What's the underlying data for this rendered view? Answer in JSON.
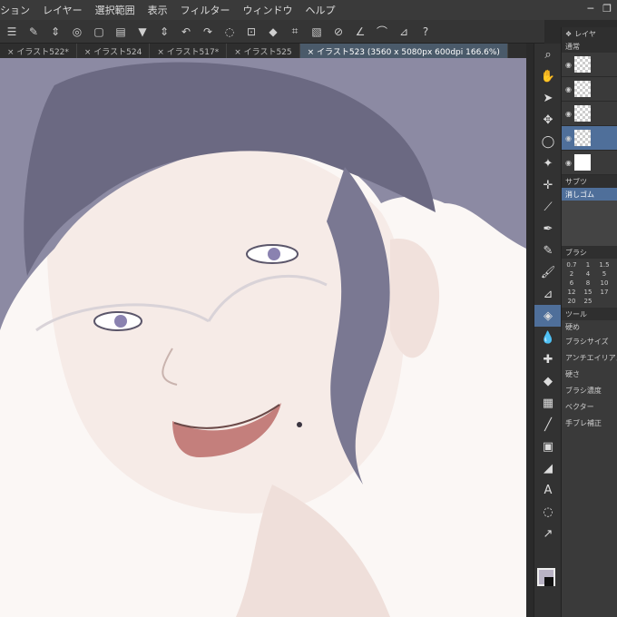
{
  "menu": {
    "items": [
      "ション",
      "レイヤー",
      "選択範囲",
      "表示",
      "フィルター",
      "ウィンドウ",
      "ヘルプ"
    ]
  },
  "tabs": [
    {
      "label": "× イラスト522*"
    },
    {
      "label": "× イラスト524"
    },
    {
      "label": "× イラスト517*"
    },
    {
      "label": "× イラスト525"
    },
    {
      "label": "× イラスト523 (3560 x 5080px 600dpi 166.6%)"
    }
  ],
  "panels": {
    "layer_header": "レイヤ",
    "blend_mode": "通常",
    "sub_tool_header": "サブツ",
    "sub_tool_selected": "消しゴム",
    "brush_header": "ブラシ",
    "brush_sizes": [
      "0.7",
      "1",
      "1.5",
      "2",
      "4",
      "5",
      "6",
      "8",
      "10",
      "12",
      "15",
      "17",
      "20",
      "25"
    ],
    "tool_prop_header": "ツール",
    "tool_prop_name": "硬め",
    "props": [
      "ブラシサイズ",
      "アンチエイリアス",
      "硬さ",
      "ブラシ濃度",
      "ベクター",
      "手ブレ補正"
    ]
  },
  "colors": {
    "main": "#b9b3c5",
    "sub": "#111111",
    "accent": "#4f6f9a"
  }
}
